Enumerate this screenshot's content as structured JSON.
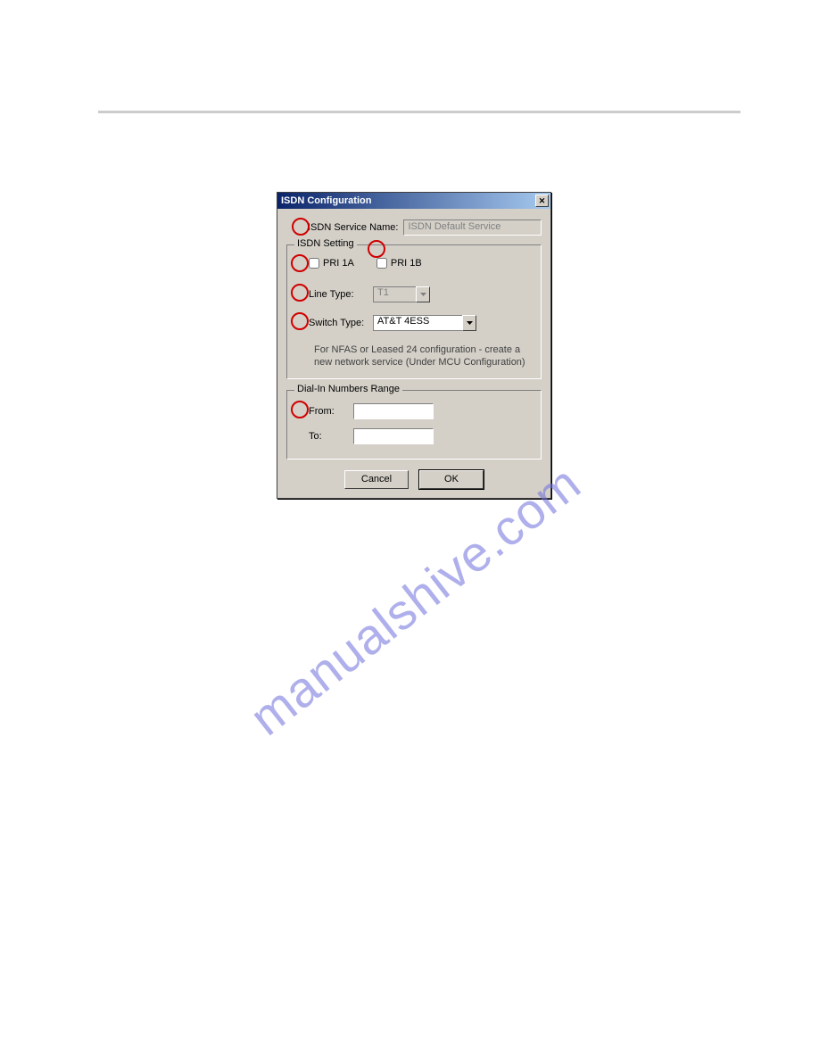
{
  "watermark_text": "manualshive.com",
  "dialog": {
    "title": "ISDN Configuration",
    "service_name_label": "ISDN Service Name:",
    "service_name_value": "ISDN Default Service",
    "group_setting_title": "ISDN Setting",
    "pri_1a_label": "PRI 1A",
    "pri_1b_label": "PRI 1B",
    "line_type_label": "Line Type:",
    "line_type_value": "T1",
    "switch_type_label": "Switch Type:",
    "switch_type_value": "AT&T 4ESS",
    "info_text_1": "For NFAS or Leased 24 configuration - create a",
    "info_text_2": "new network service (Under MCU Configuration)",
    "group_dialin_title": "Dial-In Numbers Range",
    "from_label": "From:",
    "to_label": "To:",
    "cancel_label": "Cancel",
    "ok_label": "OK"
  }
}
